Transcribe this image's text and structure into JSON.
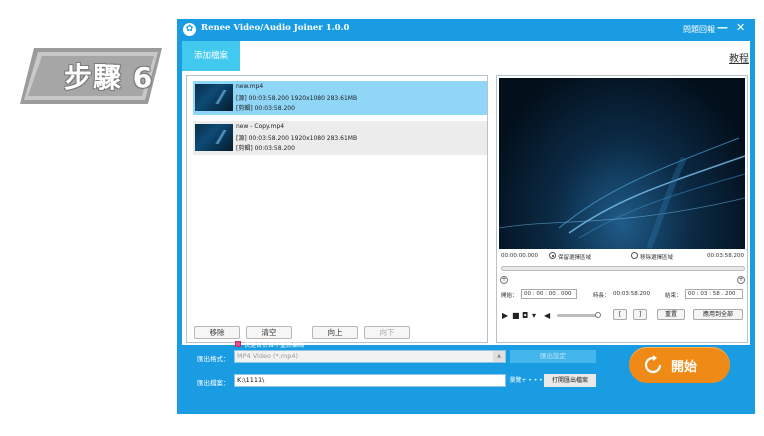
{
  "step_badge": {
    "text": "步驟 6"
  },
  "window": {
    "title": "Renee Video/Audio Joiner 1.0.0",
    "help_label": "問題回報",
    "minimize_label": "—",
    "close_label": "✕"
  },
  "toolbar": {
    "add_file_label": "添加檔案",
    "tutorial_label": "教程"
  },
  "files": [
    {
      "name": "new.mp4",
      "source_line": "[源]    00:03:58.200  1920x1080  283.61MB",
      "clip_line": "[剪輯]  00:03:58.200",
      "selected": true
    },
    {
      "name": "new - Copy.mp4",
      "source_line": "[源]    00:03:58.200  1920x1080  283.61MB",
      "clip_line": "[剪輯]  00:03:58.200",
      "selected": false
    }
  ],
  "list_buttons": {
    "remove": "移除",
    "clear": "清空",
    "move_up": "向上",
    "move_down": "向下"
  },
  "preview": {
    "time_start": "00:00:00.000",
    "keep_option": "保留選擇區域",
    "remove_option": "移除選擇區域",
    "time_end": "00:03:58.200",
    "start_label": "開始：",
    "start_value": "00 : 00 : 00 . 000",
    "duration_label": "時長：",
    "duration_value": "00:03:58.200",
    "end_label": "結束：",
    "end_value": "00 : 03 : 58 . 200",
    "bracket_open": "[",
    "bracket_close": "]",
    "reset_label": "重置",
    "apply_all_label": "應用到全部",
    "play_icon": "▶",
    "stop_icon": "■",
    "camera_icon": "◘",
    "dropdown_icon": "▾",
    "volume_icon": "◀"
  },
  "output": {
    "fast_merge_label": "快速合併且不重新編碼",
    "format_label": "匯出格式：",
    "format_value": "MP4 Video (*.mp4)",
    "settings_label": "匯出設定",
    "folder_label": "匯出檔案：",
    "folder_value": "K:\\1111\\",
    "browse_label": "瀏覽+ • • •",
    "open_folder_label": "打開匯出檔案",
    "start_label": "開始"
  },
  "colors": {
    "window_blue": "#1a9ce3",
    "selection_blue": "#8fd6f7",
    "start_orange": "#f08a16"
  }
}
